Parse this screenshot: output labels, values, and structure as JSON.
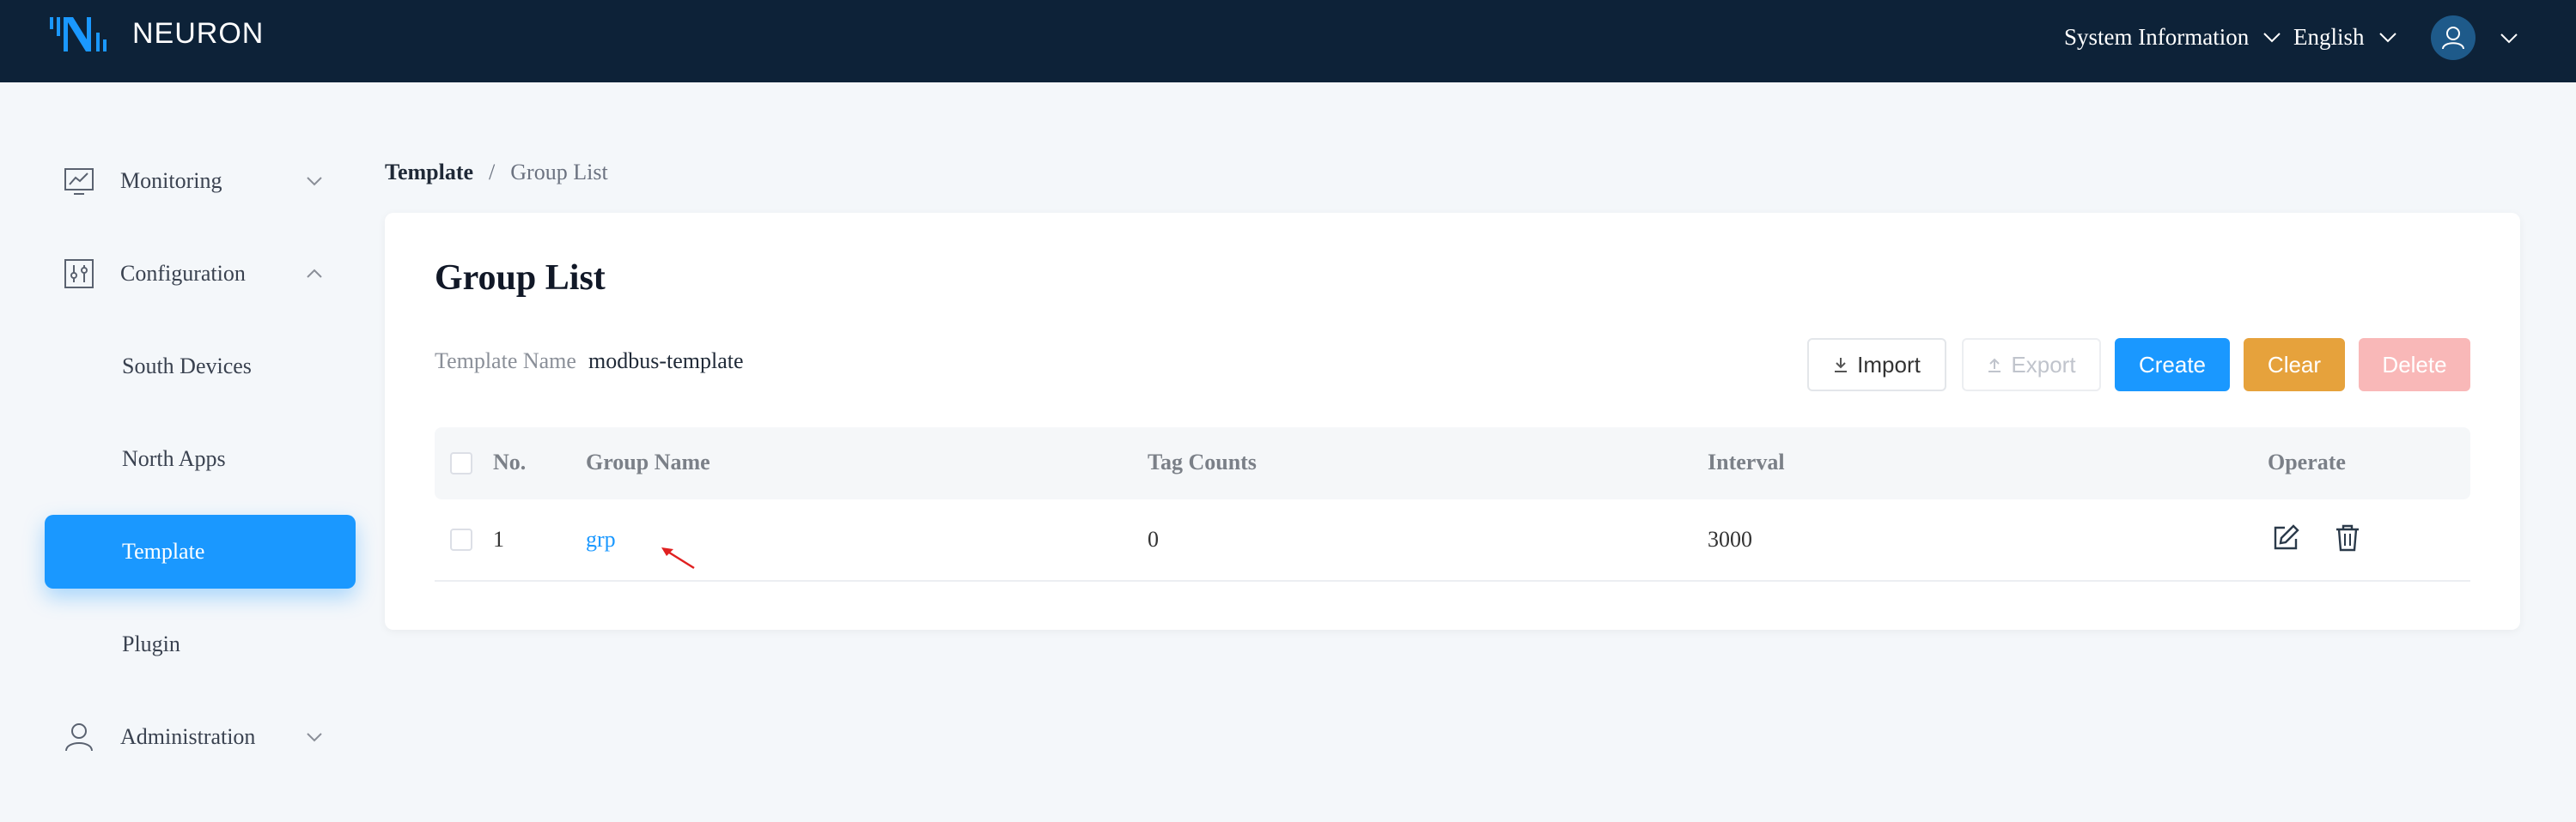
{
  "header": {
    "logo_text": "NEURON",
    "system_info_label": "System Information",
    "language_label": "English",
    "colors": {
      "bg": "#0d2238",
      "logo_accent": "#1a98ff"
    }
  },
  "sidebar": {
    "items": [
      {
        "label": "Monitoring",
        "icon": "monitor-chart-icon"
      },
      {
        "label": "Configuration",
        "icon": "sliders-icon"
      },
      {
        "label": "South Devices"
      },
      {
        "label": "North Apps"
      },
      {
        "label": "Template",
        "active": true
      },
      {
        "label": "Plugin"
      },
      {
        "label": "Administration",
        "icon": "user-icon"
      }
    ]
  },
  "breadcrumb": {
    "current": "Template",
    "separator": "/",
    "page": "Group List"
  },
  "main": {
    "title": "Group List",
    "template_name_label": "Template Name",
    "template_name_value": "modbus-template",
    "buttons": {
      "import": "Import",
      "export": "Export",
      "create": "Create",
      "clear": "Clear",
      "delete": "Delete"
    },
    "table": {
      "headers": {
        "no": "No.",
        "group_name": "Group Name",
        "tag_counts": "Tag Counts",
        "interval": "Interval",
        "operate": "Operate"
      },
      "rows": [
        {
          "no": "1",
          "group_name": "grp",
          "tag_counts": "0",
          "interval": "3000"
        }
      ]
    }
  },
  "colors": {
    "primary": "#1a98ff",
    "warning": "#e6a23c",
    "danger_disabled": "#f9b8b8"
  }
}
